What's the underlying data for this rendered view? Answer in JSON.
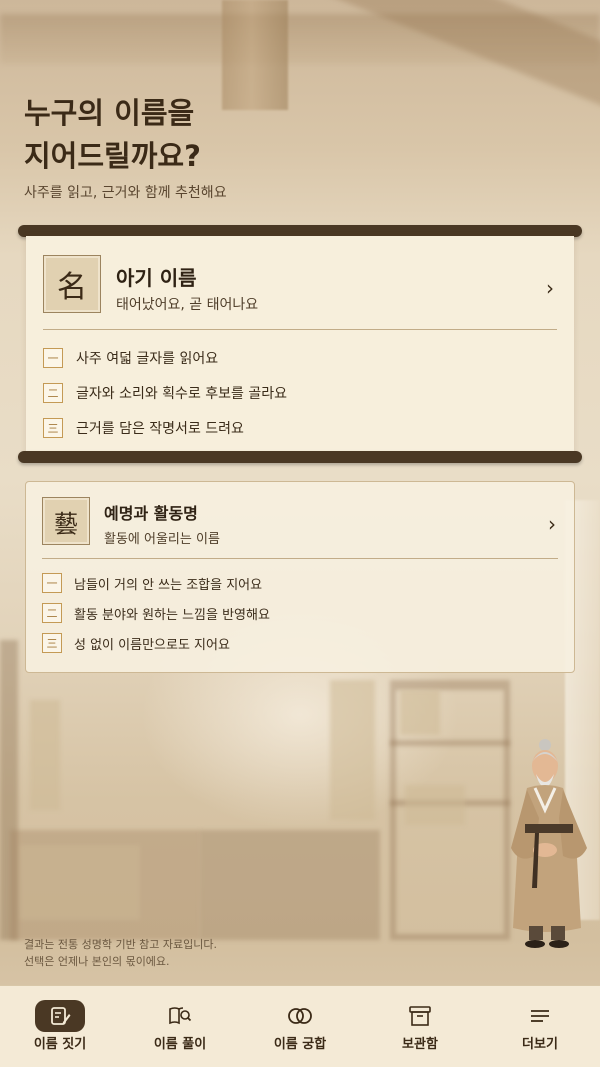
{
  "header": {
    "title_line1": "누구의 이름을",
    "title_line2": "지어드릴까요?",
    "subtitle": "사주를 읽고, 근거와 함께 추천해요"
  },
  "cards": [
    {
      "seal": "名",
      "title": "아기 이름",
      "subtitle": "태어났어요, 곧 태어나요",
      "steps": [
        {
          "num": "一",
          "text": "사주 여덟 글자를 읽어요"
        },
        {
          "num": "二",
          "text": "글자와 소리와 획수로 후보를 골라요"
        },
        {
          "num": "三",
          "text": "근거를 담은 작명서로 드려요"
        }
      ]
    },
    {
      "seal": "藝",
      "title": "예명과 활동명",
      "subtitle": "활동에 어울리는 이름",
      "steps": [
        {
          "num": "一",
          "text": "남들이 거의 안 쓰는 조합을 지어요"
        },
        {
          "num": "二",
          "text": "활동 분야와 원하는 느낌을 반영해요"
        },
        {
          "num": "三",
          "text": "성 없이 이름만으로도 지어요"
        }
      ]
    }
  ],
  "disclaimer": {
    "line1": "결과는 전통 성명학 기반 참고 자료입니다.",
    "line2": "선택은 언제나 본인의 몫이에요."
  },
  "nav": [
    {
      "label": "이름 짓기",
      "icon": "pencil-note-icon",
      "active": true
    },
    {
      "label": "이름 풀이",
      "icon": "book-search-icon",
      "active": false
    },
    {
      "label": "이름 궁합",
      "icon": "overlap-circles-icon",
      "active": false
    },
    {
      "label": "보관함",
      "icon": "archive-box-icon",
      "active": false
    },
    {
      "label": "더보기",
      "icon": "menu-lines-icon",
      "active": false
    }
  ],
  "colors": {
    "accent_dark": "#4a3824",
    "card_bg": "#f7efdc",
    "step_gold": "#c49a55"
  }
}
